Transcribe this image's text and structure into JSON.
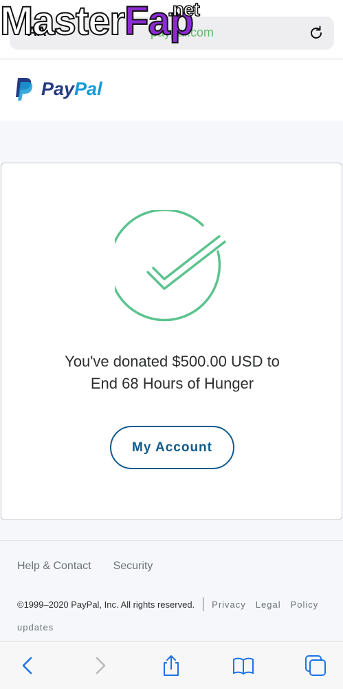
{
  "browser": {
    "watermark_main": "Master",
    "watermark_fap": "Fap",
    "watermark_net": ".net",
    "aa_label": "AA",
    "url": "paypal.com"
  },
  "header": {
    "brand_pay": "Pay",
    "brand_pal": "Pal"
  },
  "card": {
    "message_line1": "You've donated $500.00 USD to",
    "message_line2": "End 68 Hours of Hunger",
    "button_label": "My Account"
  },
  "footer": {
    "links": [
      "Help & Contact",
      "Security"
    ],
    "copyright": "©1999–2020 PayPal, Inc. All rights reserved.",
    "legal_links": [
      "Privacy",
      "Legal",
      "Policy"
    ],
    "updates": "updates"
  },
  "colors": {
    "check_green": "#5cc38f",
    "button_blue": "#0f5a8c",
    "paypal_navy": "#253b80",
    "paypal_blue": "#179bd7"
  },
  "icons": {
    "toolbar": [
      "back-icon",
      "forward-icon",
      "share-icon",
      "bookmarks-icon",
      "tabs-icon"
    ],
    "reload": "reload-icon"
  }
}
